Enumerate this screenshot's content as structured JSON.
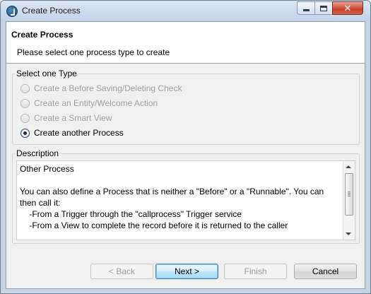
{
  "window": {
    "title": "Create Process",
    "controls": [
      "minimize",
      "maximize",
      "close"
    ]
  },
  "header": {
    "title": "Create Process",
    "subtitle": "Please select one process type to create"
  },
  "type_group": {
    "legend": "Select one Type",
    "options": [
      {
        "label": "Create a Before Saving/Deleting Check",
        "enabled": false,
        "checked": false
      },
      {
        "label": "Create an Entity/Welcome Action",
        "enabled": false,
        "checked": false
      },
      {
        "label": "Create a Smart View",
        "enabled": false,
        "checked": false
      },
      {
        "label": "Create another Process",
        "enabled": true,
        "checked": true
      }
    ]
  },
  "description_group": {
    "legend": "Description",
    "text": "Other Process\n\nYou can also define a Process that is neither a \"Before\" or a \"Runnable\". You can then call it:\n    -From a Trigger through the \"callprocess\" Trigger service\n    -From a View to complete the record before it is returned to the caller"
  },
  "buttons": {
    "back": "< Back",
    "next": "Next >",
    "finish": "Finish",
    "cancel": "Cancel"
  },
  "icons": {
    "app": "app-icon",
    "minimize": "minimize-icon",
    "maximize": "maximize-icon",
    "close": "close-icon"
  },
  "colors": {
    "title_bar": "#c2d2e6",
    "close_button": "#c7432a",
    "default_button_border": "#3c7fb1"
  }
}
